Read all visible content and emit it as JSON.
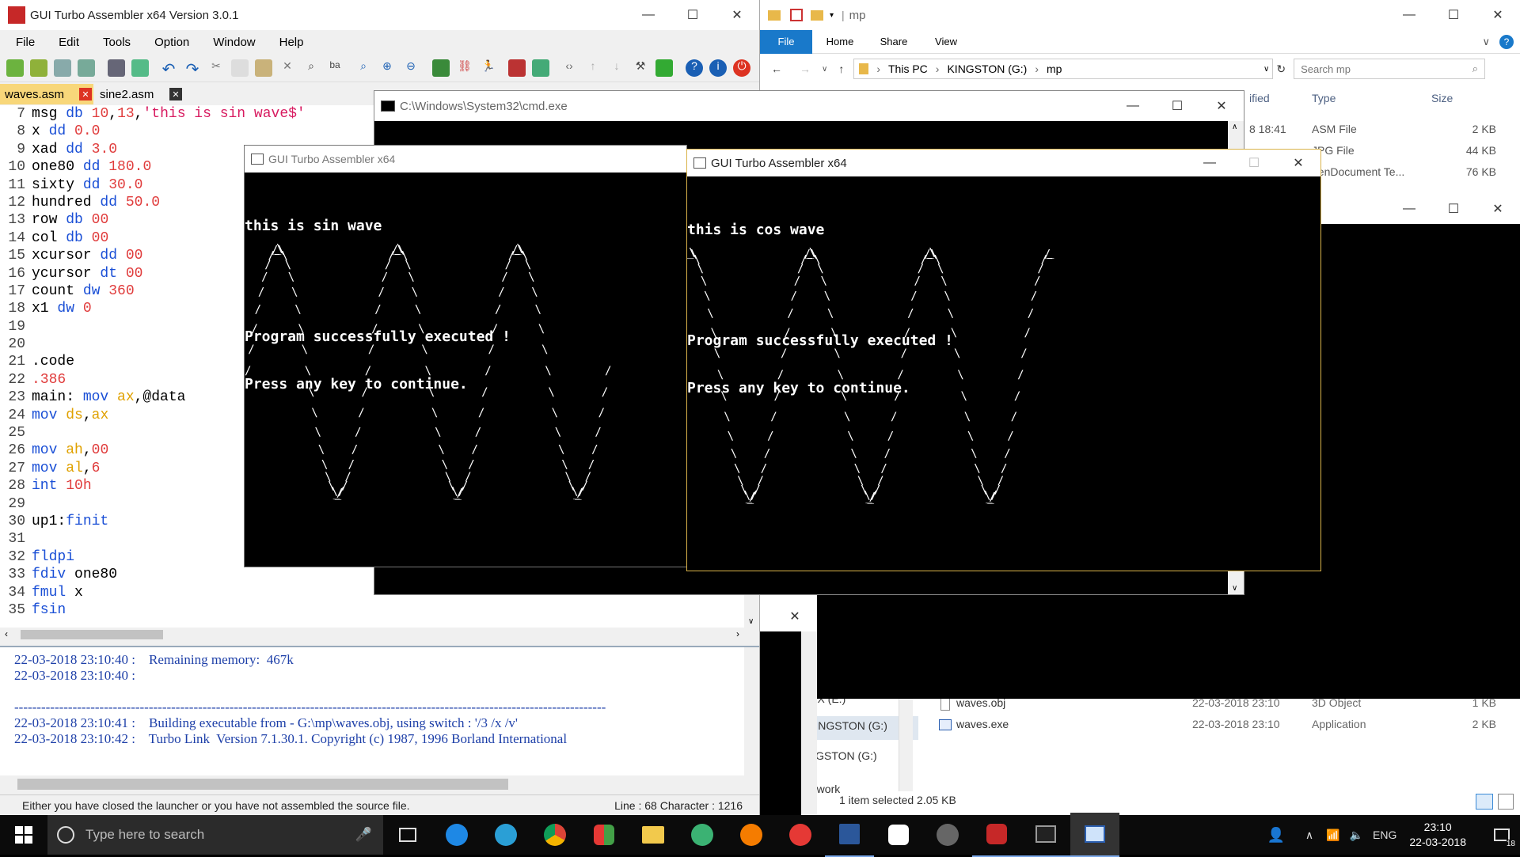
{
  "gui": {
    "title": "GUI Turbo Assembler x64 Version 3.0.1",
    "menu": [
      "File",
      "Edit",
      "Tools",
      "Option",
      "Window",
      "Help"
    ],
    "tabs": [
      {
        "label": "waves.asm",
        "active": true
      },
      {
        "label": "sine2.asm",
        "active": false
      }
    ],
    "lines": [
      {
        "n": "7",
        "t": "msg db 10,13,'this is sin wave$'"
      },
      {
        "n": "8",
        "t": "x dd 0.0"
      },
      {
        "n": "9",
        "t": "xad dd 3.0"
      },
      {
        "n": "10",
        "t": "one80 dd 180.0"
      },
      {
        "n": "11",
        "t": "sixty dd 30.0"
      },
      {
        "n": "12",
        "t": "hundred dd 50.0"
      },
      {
        "n": "13",
        "t": "row db 00"
      },
      {
        "n": "14",
        "t": "col db 00"
      },
      {
        "n": "15",
        "t": "xcursor dd 00"
      },
      {
        "n": "16",
        "t": "ycursor dt 00"
      },
      {
        "n": "17",
        "t": "count dw 360"
      },
      {
        "n": "18",
        "t": "x1 dw 0"
      },
      {
        "n": "19",
        "t": ""
      },
      {
        "n": "20",
        "t": ""
      },
      {
        "n": "21",
        "t": ".code"
      },
      {
        "n": "22",
        "t": ".386"
      },
      {
        "n": "23",
        "t": "main: mov ax,@data"
      },
      {
        "n": "24",
        "t": "mov ds,ax"
      },
      {
        "n": "25",
        "t": ""
      },
      {
        "n": "26",
        "t": "mov ah,00"
      },
      {
        "n": "27",
        "t": "mov al,6"
      },
      {
        "n": "28",
        "t": "int 10h"
      },
      {
        "n": "29",
        "t": ""
      },
      {
        "n": "30",
        "t": "up1:finit"
      },
      {
        "n": "31",
        "t": ""
      },
      {
        "n": "32",
        "t": "fldpi"
      },
      {
        "n": "33",
        "t": "fdiv one80"
      },
      {
        "n": "34",
        "t": "fmul x"
      },
      {
        "n": "35",
        "t": "fsin"
      }
    ],
    "log": [
      "22-03-2018 23:10:40 :    Remaining memory:  467k",
      "22-03-2018 23:10:40 :",
      "",
      "------------------------------------------------------------------------------------------------------------------------------------",
      "22-03-2018 23:10:41 :    Building executable from - G:\\mp\\waves.obj, using switch : '/3 /x /v'",
      "22-03-2018 23:10:42 :    Turbo Link  Version 7.1.30.1. Copyright (c) 1987, 1996 Borland International"
    ],
    "status_left": "Either you have closed the launcher or you have not assembled the source file.",
    "status_right": "Line : 68 Character : 1216"
  },
  "explorer": {
    "title": "mp",
    "ribbon": [
      "File",
      "Home",
      "Share",
      "View"
    ],
    "path": [
      "This PC",
      "KINGSTON (G:)",
      "mp"
    ],
    "search_placeholder": "Search mp",
    "columns": {
      "modified": "ified",
      "type": "Type",
      "size": "Size"
    },
    "top_rows": [
      {
        "date": "8 18:41",
        "type": "ASM File",
        "size": "2 KB"
      },
      {
        "date": "",
        "type": "JPG File",
        "size": "44 KB"
      },
      {
        "date": "",
        "type": "penDocument Te...",
        "size": "76 KB"
      }
    ],
    "bottom_rows": [
      {
        "name": "waves.obj",
        "date": "22-03-2018 23:10",
        "type": "3D Object",
        "size": "1 KB"
      },
      {
        "name": "waves.exe",
        "date": "22-03-2018 23:10",
        "type": "Application",
        "size": "2 KB"
      }
    ],
    "nav": [
      "reX (E:)",
      "KINGSTON (G:)",
      "NGSTON (G:)",
      "etwork"
    ],
    "status": "1 item selected  2.05 KB"
  },
  "cmd": {
    "title": "C:\\Windows\\System32\\cmd.exe"
  },
  "sinwin": {
    "title": "GUI Turbo Assembler x64",
    "text": [
      "this is sin wave",
      "",
      "Program successfully executed !",
      "Press any key to continue."
    ]
  },
  "coswin": {
    "title": "GUI Turbo Assembler x64",
    "text": [
      "this is cos wave",
      "",
      "Program successfully executed !",
      "Press any key to continue."
    ]
  },
  "taskbar": {
    "search_placeholder": "Type here to search",
    "lang": "ENG",
    "time": "23:10",
    "date": "22-03-2018",
    "notif": "18"
  }
}
